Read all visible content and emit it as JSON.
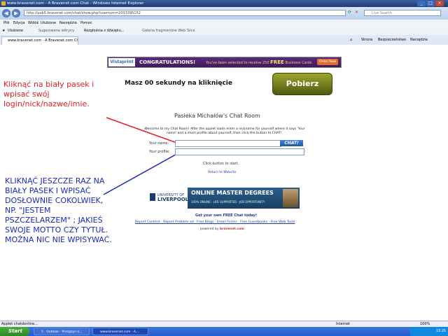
{
  "window": {
    "title": "www.bravenet.com - A Bravenet.com Chat - Windows Internet Explorer"
  },
  "address_bar": {
    "url": "http://pub5.bravenet.com/chat/show.php?usernum=2033395152",
    "search_placeholder": "Live Search"
  },
  "menu": [
    "Plik",
    "Edycja",
    "Widok",
    "Ulubione",
    "Narzędzia",
    "Pomoc"
  ],
  "favorites": {
    "label": "Ulubione",
    "items": [
      "Sugerowane witryny",
      "Rozgłośnia z dźwięku...",
      "Galeria fragmentów Web Slice"
    ]
  },
  "tab": {
    "label": "www.bravenet.com - A Bravenet.com Chat"
  },
  "tab_tools": [
    "Strona",
    "Bezpieczeństwo",
    "Narzędzia"
  ],
  "banner": {
    "brand": "Vistaprint",
    "headline": "CONGRATULATIONS!",
    "text_pre": "You've been selected to receive 250",
    "free": "FREE",
    "text_post": "Business Cards",
    "order_label": "Order Now"
  },
  "countdown_text": "Masz 00 sekundy na kliknięcie",
  "download_button": "Pobierz",
  "instruction_1": "Kliknąć na biały pasek i wpisać swój login/nick/nazwe/imie.",
  "instruction_2": "KLIKNĄĆ JESZCZE RAZ NA BIAŁY PASEK I WPISAĆ DOSŁOWNIE COKOLWIEK, NP. \"JESTEM PSZCZELARZEM\" ; JAKIEŚ SWOJE MOTTO CZY TYTUŁ. MOŻNA NIC NIE WPISYWAĆ.",
  "chat": {
    "room_title": "Pasieka Michałów's Chat Room",
    "welcome": "Welcome to my Chat Room! After the applet loads enter a nickname for yourself where it says 'Your name' and a short profile about yourself, then click the button to CHAT!.",
    "name_label": "Your name:",
    "profile_label": "Your profile:",
    "chat_button": "CHAT!",
    "click_start": "Click button to start.",
    "return_link": "Return to Website"
  },
  "ad2": {
    "univ_prefix": "UNIVERSITY OF",
    "univ_name": "LIVERPOOL",
    "headline": "ONLINE MASTER DEGREES",
    "sub": "100% ONLINE · LIFE SUPPORTED · JOB OPPORTUNITY"
  },
  "footer": {
    "get_free": "Get your own FREE Chat today!",
    "links": [
      "Report Content",
      "Report Problem ad",
      "Free Blogs",
      "Email Forms",
      "Free Guestbooks",
      "Free Web Tools"
    ],
    "powered_by": "powered by",
    "powered_brand": "bravenet.com"
  },
  "status": {
    "left": "Applet chatdonline...",
    "zone": "Internet",
    "zoom": "100%"
  },
  "taskbar": {
    "start": "Start",
    "tasks": [
      "5 - Outlook - Przegląd ni...",
      "www.bravenet.com - A..."
    ],
    "clock": "13:25"
  }
}
